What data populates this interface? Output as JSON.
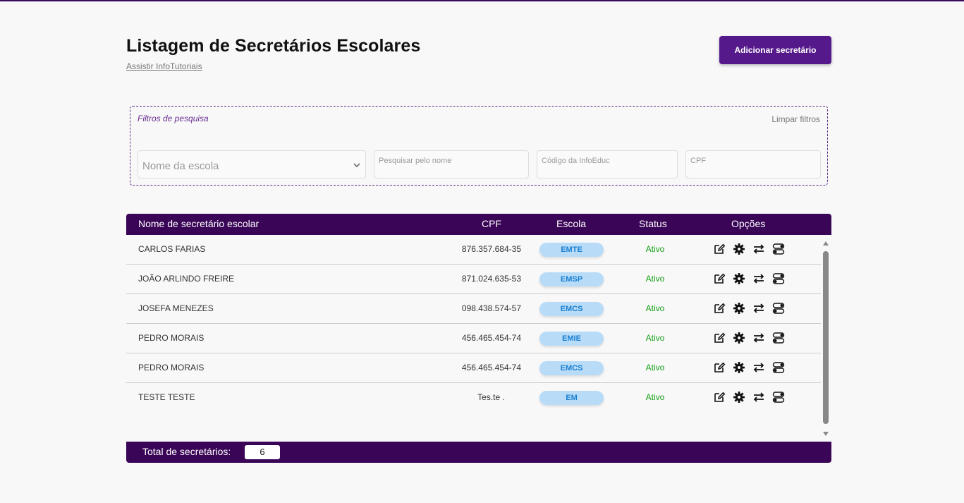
{
  "page": {
    "title": "Listagem de Secretários Escolares",
    "tutorial_link": "Assistir InfoTutoriais",
    "add_button": "Adicionar secretário"
  },
  "filters": {
    "title": "Filtros de pesquisa",
    "clear": "Limpar filtros",
    "school_select_placeholder": "Nome da escola",
    "name_placeholder": "Pesquisar pelo nome",
    "code_placeholder": "Código da InfoEduc",
    "cpf_placeholder": "CPF"
  },
  "table": {
    "columns": {
      "name": "Nome de secretário escolar",
      "cpf": "CPF",
      "school": "Escola",
      "status": "Status",
      "options": "Opções"
    },
    "rows": [
      {
        "name": "CARLOS FARIAS",
        "cpf": "876.357.684-35",
        "school": "EMTE",
        "status": "Ativo"
      },
      {
        "name": "JOÃO ARLINDO FREIRE",
        "cpf": "871.024.635-53",
        "school": "EMSP",
        "status": "Ativo"
      },
      {
        "name": "JOSEFA MENEZES",
        "cpf": "098.438.574-57",
        "school": "EMCS",
        "status": "Ativo"
      },
      {
        "name": "PEDRO MORAIS",
        "cpf": "456.465.454-74",
        "school": "EMIE",
        "status": "Ativo"
      },
      {
        "name": "PEDRO MORAIS",
        "cpf": "456.465.454-74",
        "school": "EMCS",
        "status": "Ativo"
      },
      {
        "name": "TESTE TESTE",
        "cpf": "Tes.te .",
        "school": "EM",
        "status": "Ativo"
      }
    ],
    "row_icons": [
      "edit-icon",
      "gear-icon",
      "swap-icon",
      "toggle-icon"
    ]
  },
  "footer": {
    "total_label": "Total de secretários:",
    "total_value": "6"
  },
  "colors": {
    "primary": "#3a0557",
    "button": "#55198b",
    "badge_bg": "#b8dcf8",
    "badge_text": "#1a7fd1",
    "status_active": "#14a014"
  }
}
